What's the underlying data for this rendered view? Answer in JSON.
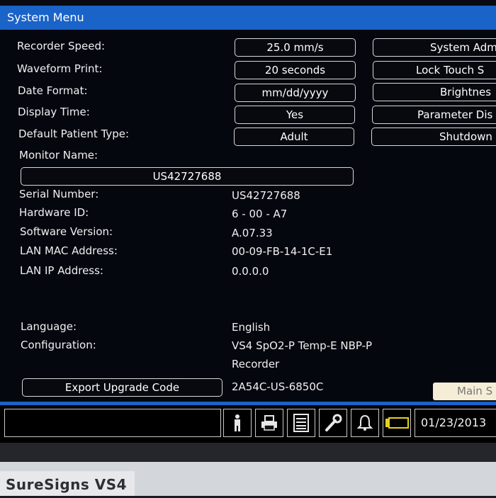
{
  "window": {
    "title": "System Menu"
  },
  "settings": {
    "recorder_speed": {
      "label": "Recorder Speed:",
      "value": "25.0 mm/s"
    },
    "waveform_print": {
      "label": "Waveform Print:",
      "value": "20 seconds"
    },
    "date_format": {
      "label": "Date Format:",
      "value": "mm/dd/yyyy"
    },
    "display_time": {
      "label": "Display Time:",
      "value": "Yes"
    },
    "default_patient_type": {
      "label": "Default Patient Type:",
      "value": "Adult"
    },
    "monitor_name": {
      "label": "Monitor Name:",
      "value": "US42727688"
    }
  },
  "info": {
    "serial_number": {
      "label": "Serial Number:",
      "value": "US42727688"
    },
    "hardware_id": {
      "label": "Hardware ID:",
      "value": "6 - 00 - A7"
    },
    "software_version": {
      "label": "Software Version:",
      "value": "A.07.33"
    },
    "lan_mac": {
      "label": "LAN MAC Address:",
      "value": "00-09-FB-14-1C-E1"
    },
    "lan_ip": {
      "label": "LAN IP Address:",
      "value": "0.0.0.0"
    },
    "language": {
      "label": "Language:",
      "value": "English"
    },
    "configuration": {
      "label": "Configuration:",
      "value_line1": "VS4 SpO2-P Temp-E NBP-P",
      "value_line2": "Recorder"
    }
  },
  "export": {
    "button_label": "Export Upgrade Code",
    "code": "2A54C-US-6850C"
  },
  "side_buttons": [
    "System Adm",
    "Lock Touch S",
    "Brightnes",
    "Parameter Dis",
    "Shutdown"
  ],
  "main_button": "Main S",
  "statusbar": {
    "icons": [
      "patient-icon",
      "print-icon",
      "report-icon",
      "wrench-icon",
      "alarm-bell-icon",
      "battery-icon"
    ],
    "date": "01/23/2013"
  },
  "device": {
    "brand": "SureSigns VS4"
  },
  "colors": {
    "title_bar": "#1a63c8",
    "screen_bg": "#05070f",
    "battery": "#e6d21e",
    "main_button_bg": "#f5edd6"
  }
}
